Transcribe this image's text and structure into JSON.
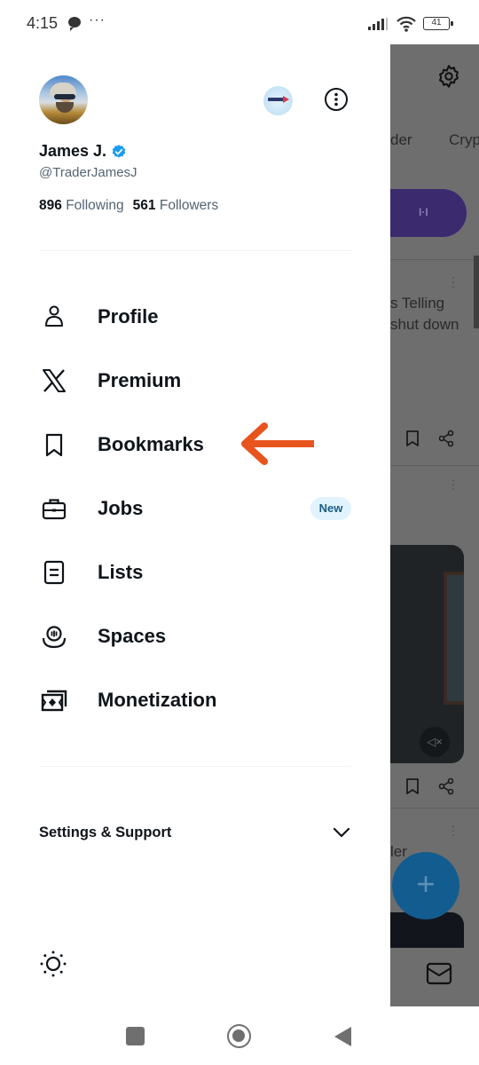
{
  "status_bar": {
    "time": "4:15",
    "overflow": "···",
    "battery": "41"
  },
  "drawer": {
    "profile": {
      "display_name": "James J.",
      "handle": "@TraderJamesJ",
      "verified": true,
      "following_count": "896",
      "following_label": "Following",
      "followers_count": "561",
      "followers_label": "Followers"
    },
    "menu": [
      {
        "label": "Profile",
        "icon": "person-icon"
      },
      {
        "label": "Premium",
        "icon": "x-logo-icon"
      },
      {
        "label": "Bookmarks",
        "icon": "bookmark-icon",
        "annotated": true
      },
      {
        "label": "Jobs",
        "icon": "briefcase-icon",
        "badge": "New"
      },
      {
        "label": "Lists",
        "icon": "list-icon"
      },
      {
        "label": "Spaces",
        "icon": "spaces-icon"
      },
      {
        "label": "Monetization",
        "icon": "money-icon"
      }
    ],
    "settings_support_label": "Settings & Support"
  },
  "background_app": {
    "tabs": [
      "der",
      "Cryp"
    ],
    "post_text_lines": [
      "s Telling",
      "shut down"
    ],
    "post2_text": "ler"
  },
  "colors": {
    "accent_blue": "#1d9bf0",
    "annotation_arrow": "#e8541e",
    "badge_bg": "#e1f3fd",
    "fab": "#135c8f"
  }
}
